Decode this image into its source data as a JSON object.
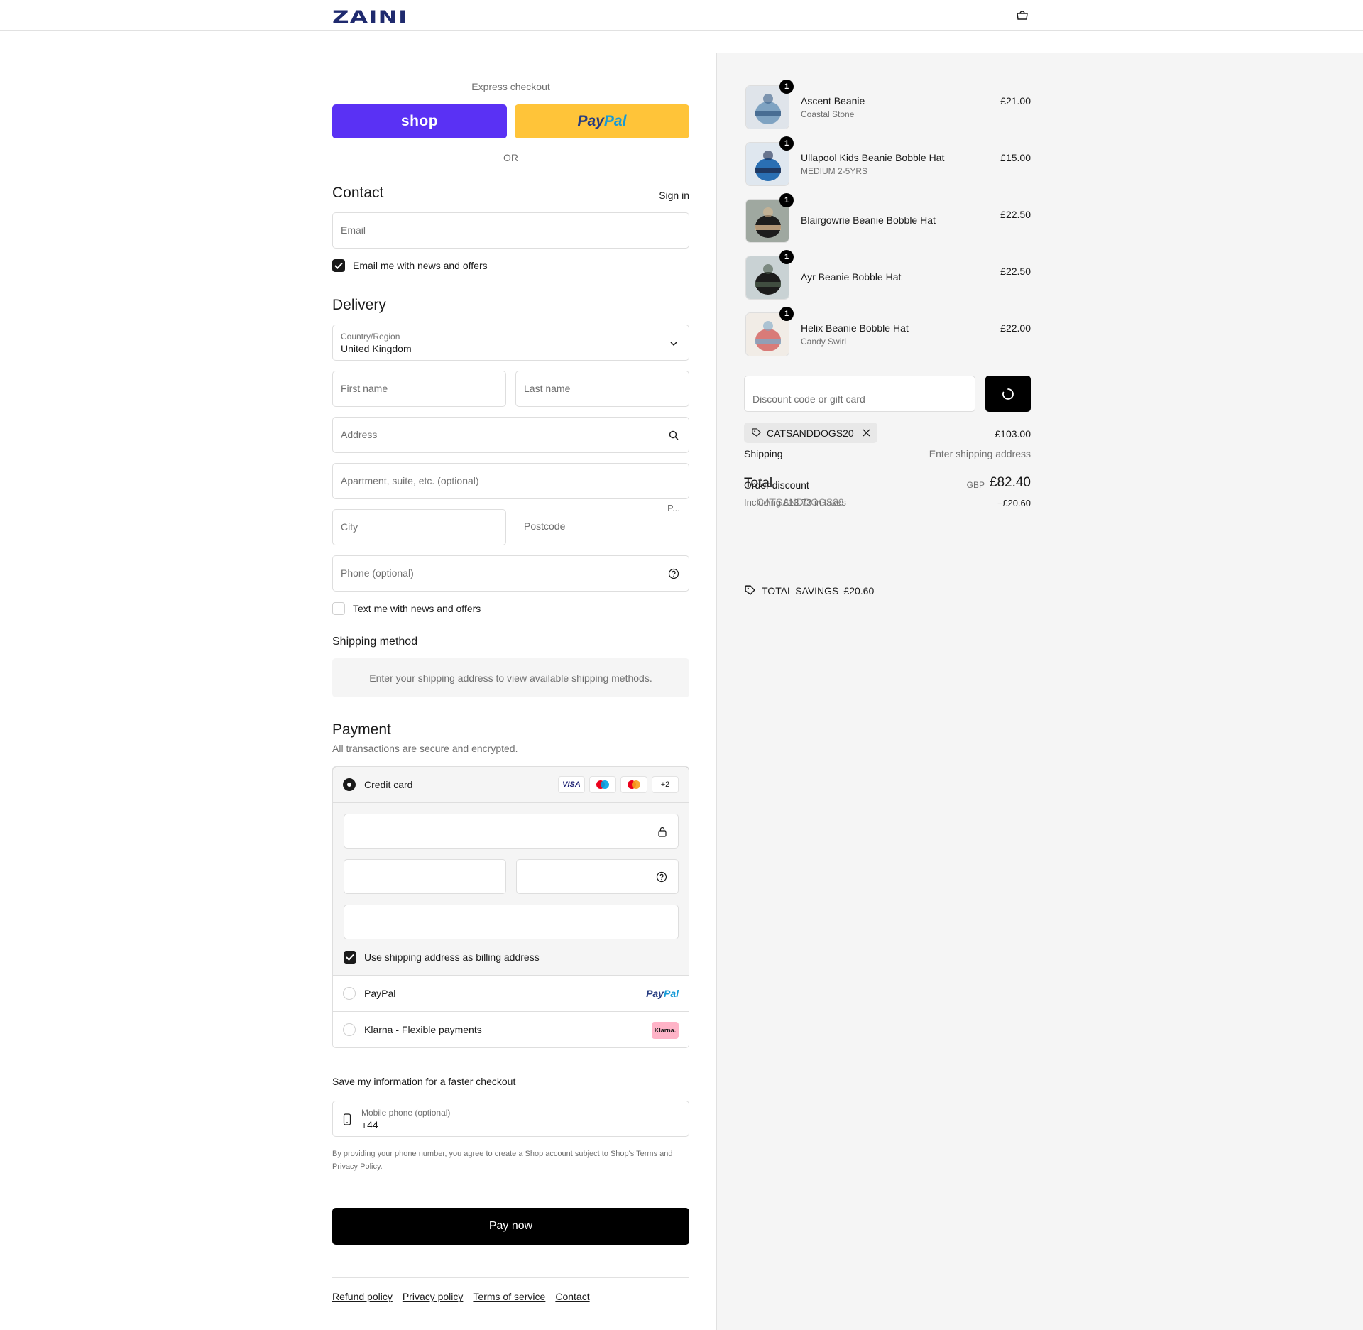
{
  "header": {
    "logo": "ZAINI",
    "cart_icon": "bag-icon"
  },
  "express": {
    "title": "Express checkout",
    "shop_label": "shop",
    "paypal_label_1": "Pay",
    "paypal_label_2": "Pal",
    "or_label": "OR"
  },
  "contact": {
    "title": "Contact",
    "sign_in": "Sign in",
    "email_placeholder": "Email",
    "email_news_label": "Email me with news and offers",
    "email_news_checked": true
  },
  "delivery": {
    "title": "Delivery",
    "country_label": "Country/Region",
    "country_value": "United Kingdom",
    "first_name": "First name",
    "last_name": "Last name",
    "address": "Address",
    "apartment": "Apartment, suite, etc. (optional)",
    "city": "City",
    "postcode": "Postcode",
    "postcode_hint": "P...",
    "phone": "Phone (optional)",
    "text_news_label": "Text me with news and offers",
    "text_news_checked": false
  },
  "shipping_method": {
    "title": "Shipping method",
    "info": "Enter your shipping address to view available shipping methods."
  },
  "payment": {
    "title": "Payment",
    "subtitle": "All transactions are secure and encrypted.",
    "credit_card_label": "Credit card",
    "card_logos": [
      "VISA",
      "maestro",
      "mastercard",
      "+2"
    ],
    "billing_label": "Use shipping address as billing address",
    "paypal_label": "PayPal",
    "paypal_logo_1": "Pay",
    "paypal_logo_2": "Pal",
    "klarna_label": "Klarna - Flexible payments",
    "klarna_logo": "Klarna."
  },
  "save_info": {
    "title": "Save my information for a faster checkout",
    "mobile_label": "Mobile phone (optional)",
    "mobile_value": "+44",
    "legal_prefix": "By providing your phone number, you agree to create a Shop account subject to Shop's",
    "legal_terms": "Terms",
    "legal_and": "and",
    "legal_privacy": "Privacy Policy",
    "legal_end": "."
  },
  "pay_now": "Pay now",
  "footer": [
    "Refund policy",
    "Privacy policy",
    "Terms of service",
    "Contact"
  ],
  "cart": {
    "items": [
      {
        "name": "Ascent Beanie",
        "variant": "Coastal Stone",
        "price": "£21.00",
        "qty": "1",
        "colors": [
          "#dfe4ea",
          "#7fa3c2",
          "#3b5f87"
        ]
      },
      {
        "name": "Ullapool Kids Beanie Bobble Hat",
        "variant": "MEDIUM 2-5YRS",
        "price": "£15.00",
        "qty": "1",
        "colors": [
          "#dfe7ef",
          "#2a6fb3",
          "#1b2a4d"
        ]
      },
      {
        "name": "Blairgowrie Beanie Bobble Hat",
        "variant": "",
        "price": "£22.50",
        "qty": "1",
        "colors": [
          "#9fa8a0",
          "#1d1d1d",
          "#d8b78e"
        ]
      },
      {
        "name": "Ayr Beanie Bobble Hat",
        "variant": "",
        "price": "£22.50",
        "qty": "1",
        "colors": [
          "#c9d2d4",
          "#1c1c1c",
          "#4a5a4a"
        ]
      },
      {
        "name": "Helix Beanie Bobble Hat",
        "variant": "Candy Swirl",
        "price": "£22.00",
        "qty": "1",
        "colors": [
          "#f1ece6",
          "#d97b78",
          "#7fa9c6"
        ]
      }
    ],
    "discount_placeholder": "Discount code or gift card",
    "applied_code": "CATSANDDOGS20",
    "subtotal": "£103.00",
    "shipping_label": "Shipping",
    "shipping_value": "Enter shipping address",
    "total_label": "Total",
    "order_discount_label": "Order discount",
    "currency": "GBP",
    "total_value": "£82.40",
    "discount_code_line": "CATSANDDOGS20",
    "including_taxes": "Including £13.73 in taxes",
    "discount_value": "−£20.60",
    "savings_label": "TOTAL SAVINGS",
    "savings_value": "£20.60"
  },
  "colors": {
    "shop": "#5a31f4",
    "paypal": "#ffc439",
    "paypal_dark": "#253b80",
    "paypal_light": "#179bd7",
    "klarna": "#ffb3c7",
    "logo": "#1f2a6e"
  }
}
